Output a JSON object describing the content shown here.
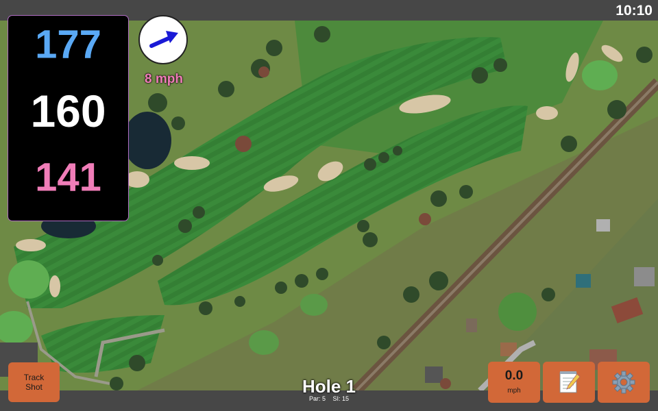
{
  "status_bar": {
    "time": "10:10"
  },
  "distances": {
    "back": "177",
    "middle": "160",
    "front": "141"
  },
  "wind": {
    "speed_label": "8 mph",
    "icon": "wind-direction-arrow-icon"
  },
  "buttons": {
    "track_shot_line1": "Track",
    "track_shot_line2": "Shot",
    "speed_value": "0.0",
    "speed_unit": "mph",
    "notes_icon": "notepad-icon",
    "settings_icon": "gear-icon"
  },
  "hole": {
    "title": "Hole 1",
    "par": "Par: 5",
    "stroke_index": "SI: 15"
  },
  "colors": {
    "back_distance": "#5aa9f5",
    "middle_distance": "#ffffff",
    "front_distance": "#f07db8",
    "button": "#d26838",
    "bar": "#474747"
  }
}
